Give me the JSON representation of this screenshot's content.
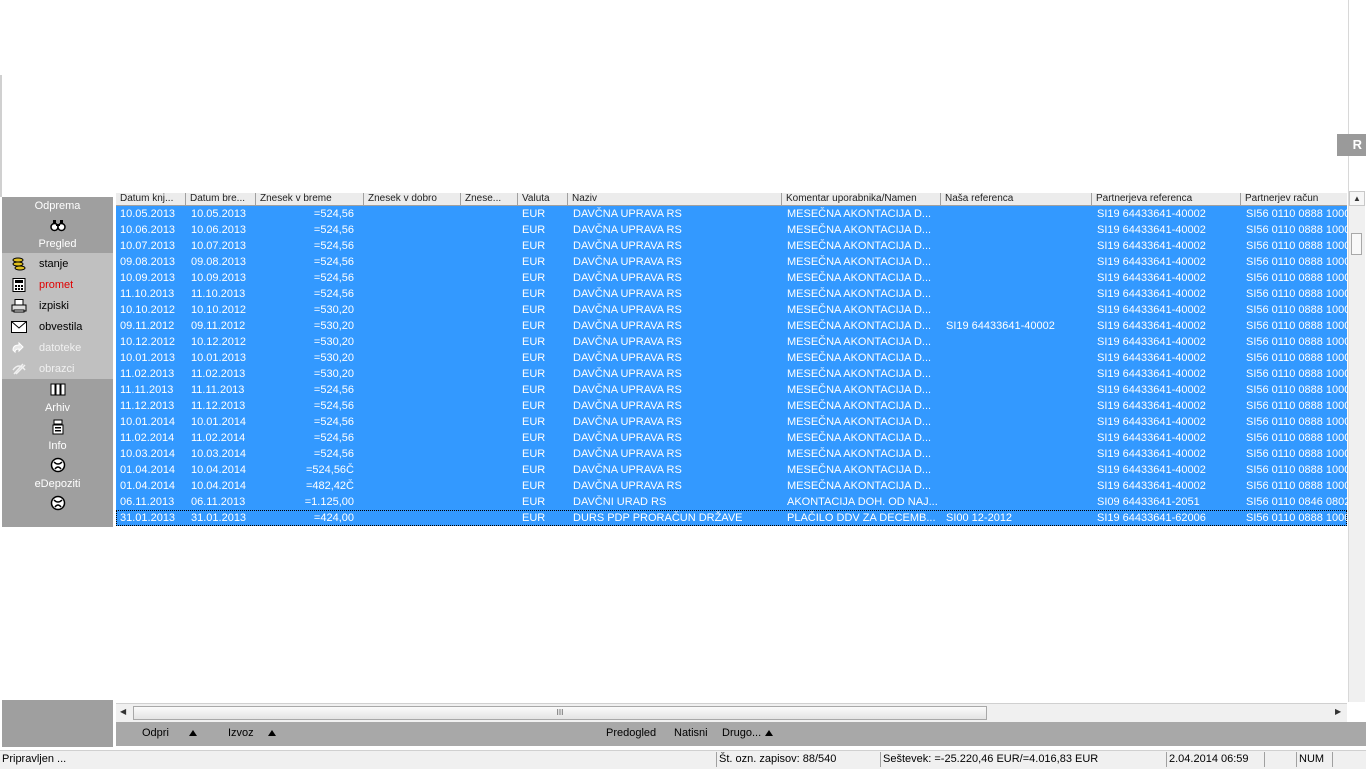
{
  "sidebar": {
    "odprema_label": "Odprema",
    "pregled_label": "Pregled",
    "items": [
      {
        "label": "stanje"
      },
      {
        "label": "promet"
      },
      {
        "label": "izpiski"
      },
      {
        "label": "obvestila"
      },
      {
        "label": "datoteke"
      },
      {
        "label": "obrazci"
      }
    ],
    "arhiv_label": "Arhiv",
    "info_label": "Info",
    "edepoziti_label": "eDepoziti"
  },
  "colors": {
    "selection_blue": "#3399ff",
    "active_item_red": "#e00000",
    "sidebar_gray": "#9f9f9f"
  },
  "grid": {
    "columns": [
      "Datum knj...",
      "Datum bre...",
      "Znesek v breme",
      "Znesek v dobro",
      "Znese...",
      "Valuta",
      "Naziv",
      "Komentar uporabnika/Namen",
      "Naša referenca",
      "Partnerjeva referenca",
      "Partnerjev račun"
    ],
    "rows": [
      [
        "10.05.2013",
        "10.05.2013",
        "=524,56",
        "",
        "",
        "EUR",
        "DAVČNA UPRAVA RS",
        "MESEČNA AKONTACIJA D...",
        "",
        "SI19 64433641-40002",
        "SI56 0110 0888 1000"
      ],
      [
        "10.06.2013",
        "10.06.2013",
        "=524,56",
        "",
        "",
        "EUR",
        "DAVČNA UPRAVA RS",
        "MESEČNA AKONTACIJA D...",
        "",
        "SI19 64433641-40002",
        "SI56 0110 0888 1000"
      ],
      [
        "10.07.2013",
        "10.07.2013",
        "=524,56",
        "",
        "",
        "EUR",
        "DAVČNA UPRAVA RS",
        "MESEČNA AKONTACIJA D...",
        "",
        "SI19 64433641-40002",
        "SI56 0110 0888 1000"
      ],
      [
        "09.08.2013",
        "09.08.2013",
        "=524,56",
        "",
        "",
        "EUR",
        "DAVČNA UPRAVA RS",
        "MESEČNA AKONTACIJA D...",
        "",
        "SI19 64433641-40002",
        "SI56 0110 0888 1000"
      ],
      [
        "10.09.2013",
        "10.09.2013",
        "=524,56",
        "",
        "",
        "EUR",
        "DAVČNA UPRAVA RS",
        "MESEČNA AKONTACIJA D...",
        "",
        "SI19 64433641-40002",
        "SI56 0110 0888 1000"
      ],
      [
        "11.10.2013",
        "11.10.2013",
        "=524,56",
        "",
        "",
        "EUR",
        "DAVČNA UPRAVA RS",
        "MESEČNA AKONTACIJA D...",
        "",
        "SI19 64433641-40002",
        "SI56 0110 0888 1000"
      ],
      [
        "10.10.2012",
        "10.10.2012",
        "=530,20",
        "",
        "",
        "EUR",
        "DAVČNA UPRAVA RS",
        "MESEČNA AKONTACIJA D...",
        "",
        "SI19 64433641-40002",
        "SI56 0110 0888 1000"
      ],
      [
        "09.11.2012",
        "09.11.2012",
        "=530,20",
        "",
        "",
        "EUR",
        "DAVČNA UPRAVA RS",
        "MESEČNA AKONTACIJA D...",
        "SI19 64433641-40002",
        "SI19 64433641-40002",
        "SI56 0110 0888 1000"
      ],
      [
        "10.12.2012",
        "10.12.2012",
        "=530,20",
        "",
        "",
        "EUR",
        "DAVČNA UPRAVA RS",
        "MESEČNA AKONTACIJA D...",
        "",
        "SI19 64433641-40002",
        "SI56 0110 0888 1000"
      ],
      [
        "10.01.2013",
        "10.01.2013",
        "=530,20",
        "",
        "",
        "EUR",
        "DAVČNA UPRAVA RS",
        "MESEČNA AKONTACIJA D...",
        "",
        "SI19 64433641-40002",
        "SI56 0110 0888 1000"
      ],
      [
        "11.02.2013",
        "11.02.2013",
        "=530,20",
        "",
        "",
        "EUR",
        "DAVČNA UPRAVA RS",
        "MESEČNA AKONTACIJA D...",
        "",
        "SI19 64433641-40002",
        "SI56 0110 0888 1000"
      ],
      [
        "11.11.2013",
        "11.11.2013",
        "=524,56",
        "",
        "",
        "EUR",
        "DAVČNA UPRAVA RS",
        "MESEČNA AKONTACIJA D...",
        "",
        "SI19 64433641-40002",
        "SI56 0110 0888 1000"
      ],
      [
        "11.12.2013",
        "11.12.2013",
        "=524,56",
        "",
        "",
        "EUR",
        "DAVČNA UPRAVA RS",
        "MESEČNA AKONTACIJA D...",
        "",
        "SI19 64433641-40002",
        "SI56 0110 0888 1000"
      ],
      [
        "10.01.2014",
        "10.01.2014",
        "=524,56",
        "",
        "",
        "EUR",
        "DAVČNA UPRAVA RS",
        "MESEČNA AKONTACIJA D...",
        "",
        "SI19 64433641-40002",
        "SI56 0110 0888 1000"
      ],
      [
        "11.02.2014",
        "11.02.2014",
        "=524,56",
        "",
        "",
        "EUR",
        "DAVČNA UPRAVA RS",
        "MESEČNA AKONTACIJA D...",
        "",
        "SI19 64433641-40002",
        "SI56 0110 0888 1000"
      ],
      [
        "10.03.2014",
        "10.03.2014",
        "=524,56",
        "",
        "",
        "EUR",
        "DAVČNA UPRAVA RS",
        "MESEČNA AKONTACIJA D...",
        "",
        "SI19 64433641-40002",
        "SI56 0110 0888 1000"
      ],
      [
        "01.04.2014",
        "10.04.2014",
        "=524,56Č",
        "",
        "",
        "EUR",
        "DAVČNA UPRAVA RS",
        "MESEČNA AKONTACIJA D...",
        "",
        "SI19 64433641-40002",
        "SI56 0110 0888 1000"
      ],
      [
        "01.04.2014",
        "10.04.2014",
        "=482,42Č",
        "",
        "",
        "EUR",
        "DAVČNA UPRAVA RS",
        "MESEČNA AKONTACIJA D...",
        "",
        "SI19 64433641-40002",
        "SI56 0110 0888 1000"
      ],
      [
        "06.11.2013",
        "06.11.2013",
        "=1.125,00",
        "",
        "",
        "EUR",
        "DAVČNI URAD RS",
        "AKONTACIJA DOH. OD NAJ...",
        "",
        "SI09 64433641-2051",
        "SI56 0110 0846 0802"
      ],
      [
        "31.01.2013",
        "31.01.2013",
        "=424,00",
        "",
        "",
        "EUR",
        "DURS PDP PRORAČUN DRŽAVE",
        "PLAČILO DDV ZA DECEMB...",
        "SI00 12-2012",
        "SI19 64433641-62006",
        "SI56 0110 0888 1000"
      ]
    ]
  },
  "toolbar": {
    "odpri_label": "Odpri",
    "izvoz_label": "Izvoz",
    "predogled_label": "Predogled",
    "natisni_label": "Natisni",
    "drugo_label": "Drugo..."
  },
  "hscroll": {
    "grip": "III"
  },
  "statusbar": {
    "ready": "Pripravljen ...",
    "records": "Št. ozn. zapisov: 88/540",
    "sum": "Seštevek: =-25.220,46 EUR/=4.016,83 EUR",
    "datetime": "2.04.2014 06:59",
    "num": "NUM"
  },
  "ghost": {
    "r_letter": "R"
  }
}
